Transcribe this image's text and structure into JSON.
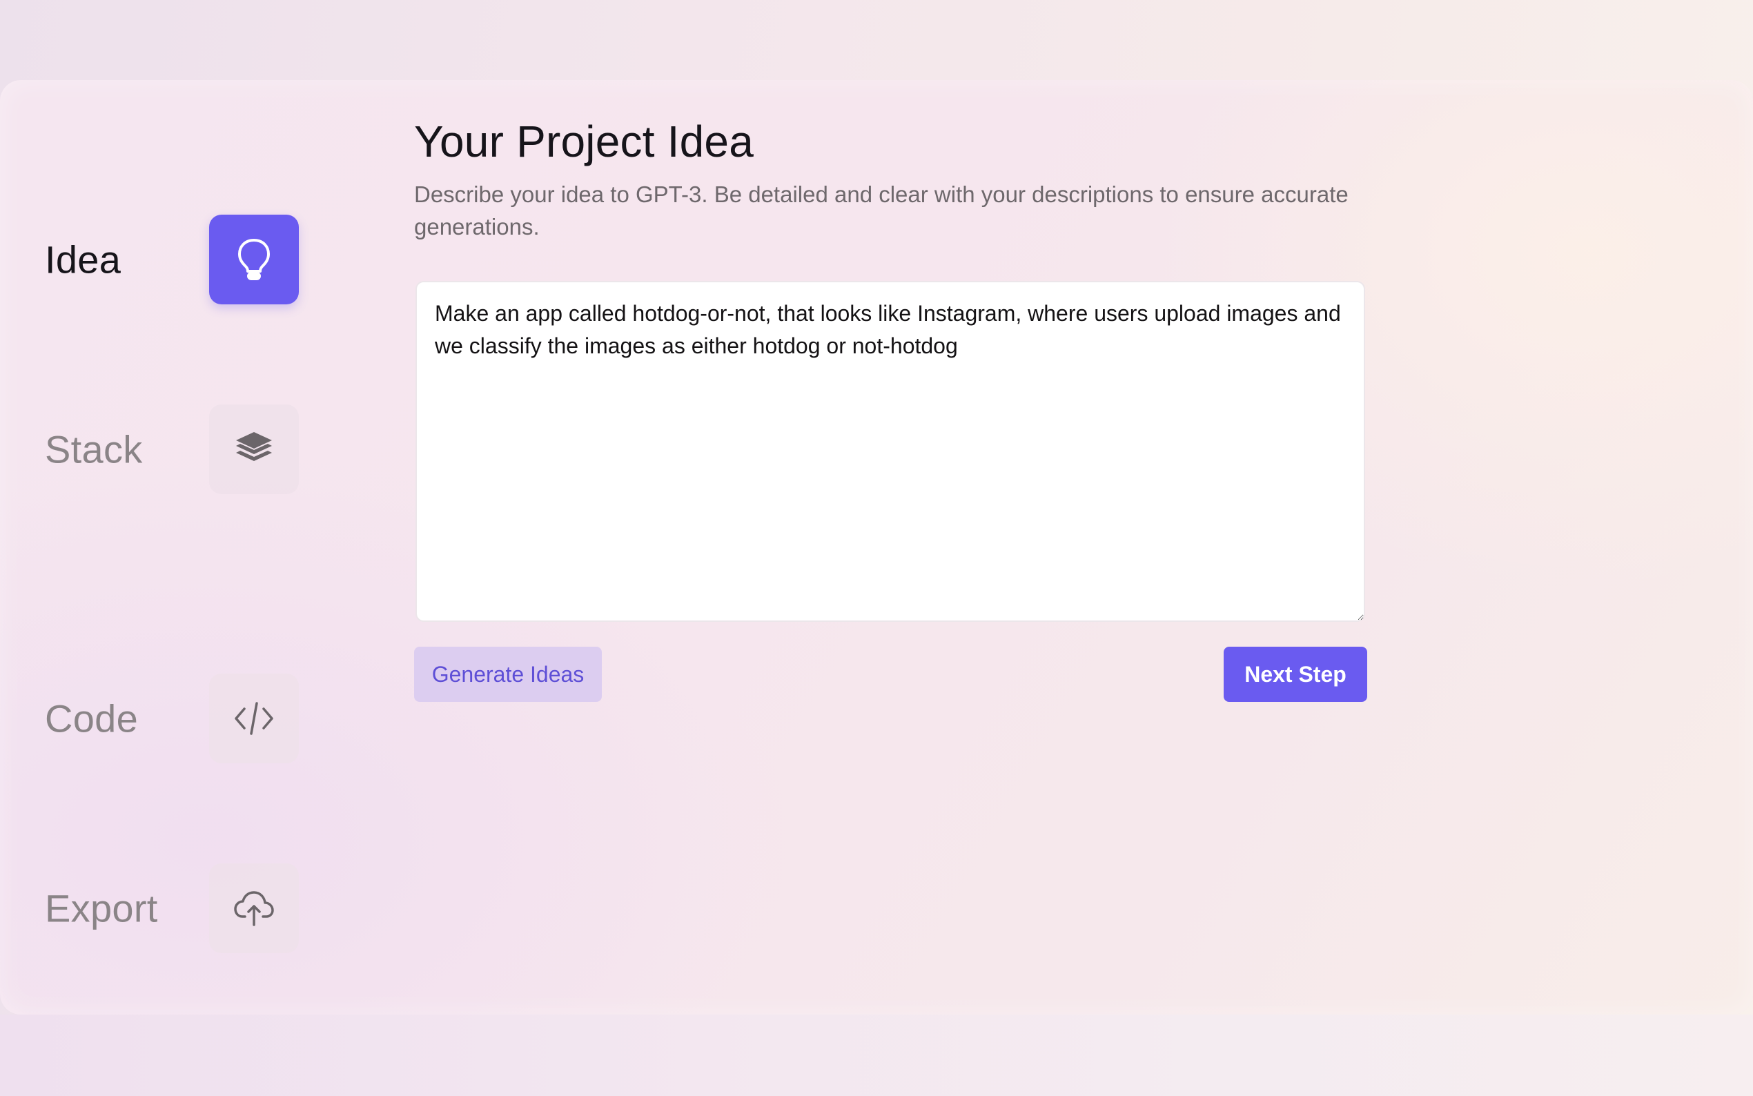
{
  "sidebar": {
    "steps": [
      {
        "label": "Idea",
        "icon": "lightbulb-icon",
        "active": true
      },
      {
        "label": "Stack",
        "icon": "layers-icon",
        "active": false
      },
      {
        "label": "Code",
        "icon": "code-icon",
        "active": false
      },
      {
        "label": "Export",
        "icon": "cloud-upload-icon",
        "active": false
      }
    ]
  },
  "main": {
    "title": "Your Project Idea",
    "subtitle": "Describe your idea to GPT-3. Be detailed and clear with your descriptions to ensure accurate generations.",
    "idea_input": {
      "value": "Make an app called hotdog-or-not, that looks like Instagram, where users upload images and we classify the images as either hotdog or not-hotdog",
      "placeholder": ""
    },
    "buttons": {
      "generate_label": "Generate Ideas",
      "next_label": "Next Step"
    }
  },
  "colors": {
    "accent": "#6a5bf0",
    "accent_soft": "#dccdf0",
    "inactive_text": "#8a8487"
  }
}
